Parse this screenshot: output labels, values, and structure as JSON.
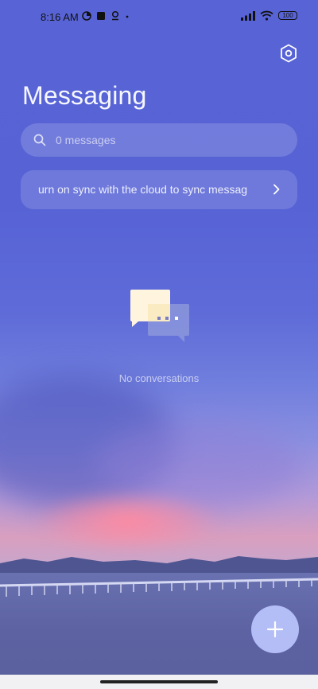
{
  "status_bar": {
    "time": "8:16 AM",
    "battery": "100"
  },
  "header": {
    "title": "Messaging"
  },
  "search": {
    "placeholder": "0 messages"
  },
  "sync_banner": {
    "text": "urn on sync with the cloud to sync messag"
  },
  "empty_state": {
    "text": "No conversations"
  },
  "icons": {
    "settings": "settings-hexagon-icon",
    "search": "search-icon",
    "sync_chevron": "chevron-right-icon",
    "empty": "chat-bubbles-icon",
    "fab": "plus-icon"
  },
  "colors": {
    "accent": "#5864d6",
    "fab": "#bec8ff"
  }
}
